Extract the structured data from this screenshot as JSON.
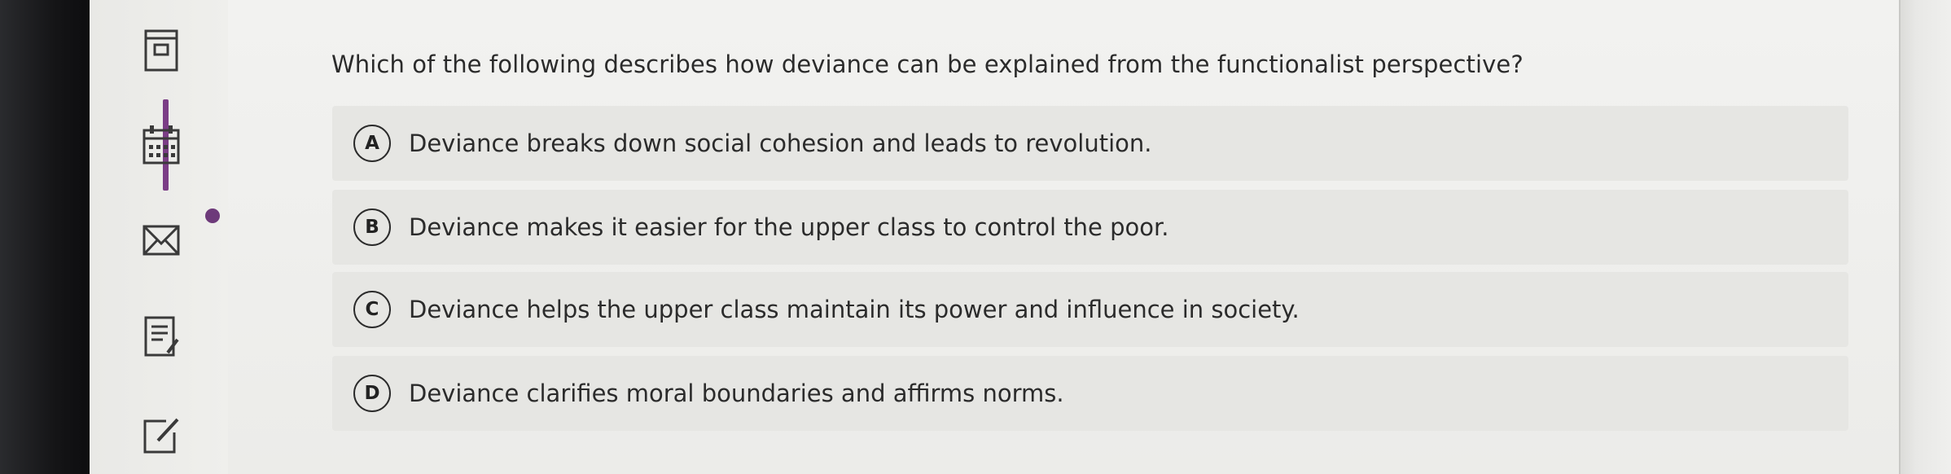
{
  "quiz": {
    "question": "Which of the following describes how deviance can be explained from the functionalist perspective?",
    "options": [
      {
        "letter": "A",
        "text": "Deviance breaks down social cohesion and leads to revolution."
      },
      {
        "letter": "B",
        "text": "Deviance makes it easier for the upper class to control the poor."
      },
      {
        "letter": "C",
        "text": "Deviance helps the upper class maintain its power and influence in society."
      },
      {
        "letter": "D",
        "text": "Deviance clarifies moral boundaries and affirms norms."
      }
    ]
  },
  "sidebar": {
    "icons": [
      "book-icon",
      "calendar-icon",
      "mail-icon",
      "notes-icon",
      "edit-icon"
    ],
    "active_index": 1,
    "accent_color": "#7b3d86"
  }
}
